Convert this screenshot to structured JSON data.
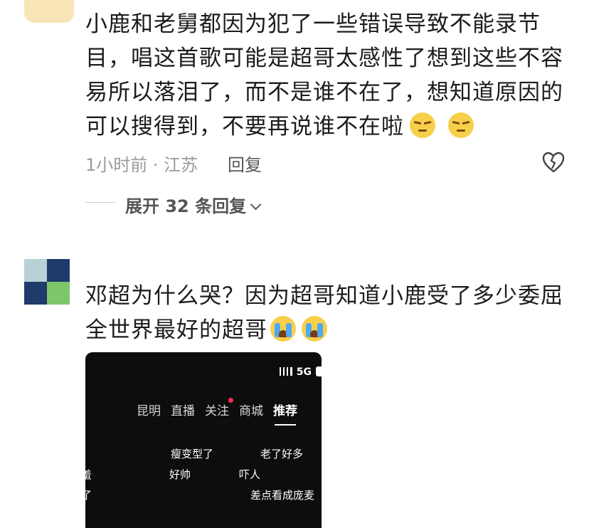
{
  "comment1": {
    "text": "小鹿和老舅都因为犯了一些错误导致不能录节目，唱这首歌可能是超哥太感性了想到这些不容易所以落泪了，而不是谁不在了，想知道原因的可以搜得到，不要再说谁不在啦",
    "emojis": [
      "smirk-emoji",
      "smirk-emoji"
    ],
    "time_location": "1小时前 · 江苏",
    "reply_label": "回复",
    "expand_replies": "展开 32 条回复"
  },
  "comment2": {
    "text": "邓超为什么哭？因为超哥知道小鹿受了多少委屈 全世界最好的超哥",
    "emojis": [
      "crying-emoji",
      "crying-emoji"
    ],
    "image": {
      "status": "5G",
      "tabs": [
        "昆明",
        "直播",
        "关注",
        "商城",
        "推荐"
      ],
      "active_tab": "推荐",
      "danmaku": [
        "瘦变型了",
        "老了好多",
        "好帅",
        "吓人",
        "差点看成庞麦",
        "羞",
        "了"
      ]
    }
  },
  "colors": {
    "text": "#1c1c1c",
    "meta": "#9a9a9a",
    "accent_dot": "#fe2c55",
    "avatar_tiles": [
      "#b8d1d6",
      "#1e3b6b",
      "#1e3b6b",
      "#7bc76a"
    ]
  }
}
